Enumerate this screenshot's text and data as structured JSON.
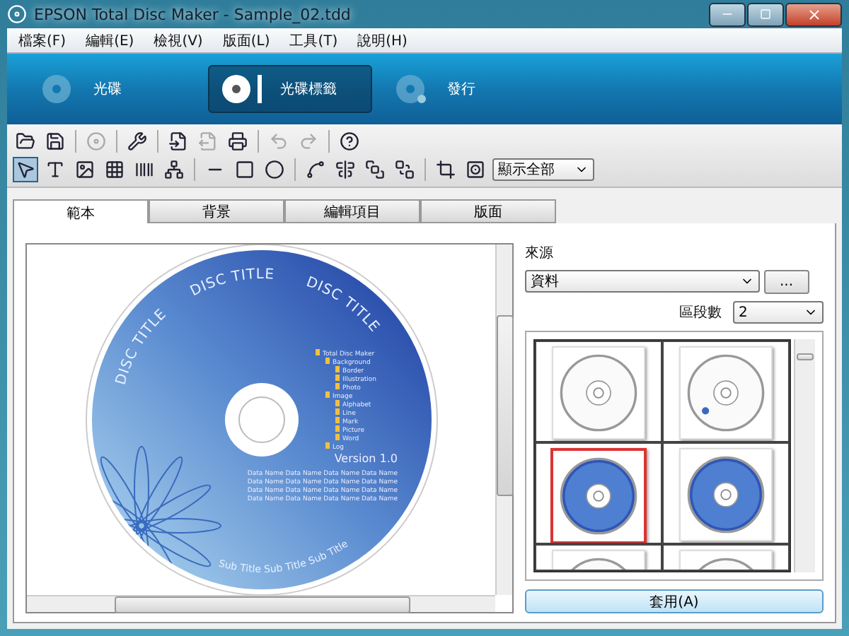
{
  "window": {
    "title": "EPSON Total Disc Maker - Sample_02.tdd"
  },
  "menu": [
    "檔案(F)",
    "編輯(E)",
    "檢視(V)",
    "版面(L)",
    "工具(T)",
    "說明(H)"
  ],
  "modes": [
    {
      "label": "光碟",
      "selected": false,
      "kind": "disc"
    },
    {
      "label": "光碟標籤",
      "selected": true,
      "kind": "label"
    },
    {
      "label": "發行",
      "selected": false,
      "kind": "publish"
    }
  ],
  "toolbar": [
    {
      "kind": "open",
      "disabled": false
    },
    {
      "kind": "save",
      "disabled": false
    },
    {
      "kind": "sep"
    },
    {
      "kind": "disc",
      "disabled": true
    },
    {
      "kind": "sep"
    },
    {
      "kind": "tools",
      "disabled": false
    },
    {
      "kind": "sep"
    },
    {
      "kind": "import",
      "disabled": false
    },
    {
      "kind": "export",
      "disabled": true
    },
    {
      "kind": "print",
      "disabled": false
    },
    {
      "kind": "sep"
    },
    {
      "kind": "undo",
      "disabled": true
    },
    {
      "kind": "redo",
      "disabled": true
    },
    {
      "kind": "sep"
    },
    {
      "kind": "help",
      "disabled": false
    }
  ],
  "tools": [
    {
      "kind": "pointer",
      "selected": true
    },
    {
      "kind": "text",
      "selected": false
    },
    {
      "kind": "image",
      "selected": false
    },
    {
      "kind": "grid",
      "selected": false
    },
    {
      "kind": "barcode",
      "selected": false
    },
    {
      "kind": "tree",
      "selected": false
    },
    {
      "kind": "sep"
    },
    {
      "kind": "line",
      "selected": false
    },
    {
      "kind": "rect",
      "selected": false
    },
    {
      "kind": "ellipse",
      "selected": false
    },
    {
      "kind": "sep"
    },
    {
      "kind": "curve",
      "selected": false
    },
    {
      "kind": "align",
      "selected": false
    },
    {
      "kind": "front",
      "selected": false
    },
    {
      "kind": "back",
      "selected": false
    },
    {
      "kind": "sep"
    },
    {
      "kind": "crop",
      "selected": false
    },
    {
      "kind": "discview",
      "selected": false
    }
  ],
  "view_select": {
    "value": "顯示全部"
  },
  "tabs": [
    {
      "label": "範本",
      "selected": true
    },
    {
      "label": "背景",
      "selected": false
    },
    {
      "label": "編輯項目",
      "selected": false
    },
    {
      "label": "版面",
      "selected": false
    }
  ],
  "disc": {
    "title_parts": [
      "DISC TITLE",
      "DISC TITLE",
      "DISC TITLE"
    ],
    "subtitle": "Sub Title Sub Title Sub Title",
    "version": "Version 1.0",
    "tree": [
      {
        "label": "Total Disc Maker",
        "children": [
          {
            "label": "Background",
            "children": [
              {
                "label": "Border"
              },
              {
                "label": "Illustration"
              },
              {
                "label": "Photo"
              }
            ]
          },
          {
            "label": "Image",
            "children": [
              {
                "label": "Alphabet"
              },
              {
                "label": "Line"
              },
              {
                "label": "Mark"
              },
              {
                "label": "Picture"
              },
              {
                "label": "Word"
              }
            ]
          },
          {
            "label": "Log"
          }
        ]
      }
    ],
    "data_lines": [
      "Data Name Data Name Data Name Data Name",
      "Data Name Data Name Data Name Data Name",
      "Data Name Data Name Data Name Data Name",
      "Data Name Data Name Data Name Data Name"
    ]
  },
  "source": {
    "label": "來源",
    "value": "資料",
    "browse": "..."
  },
  "segments": {
    "label": "區段數",
    "value": "2"
  },
  "thumbnails": [
    {
      "kind": "white",
      "selected": false
    },
    {
      "kind": "white-flower",
      "selected": false
    },
    {
      "kind": "blue",
      "selected": true
    },
    {
      "kind": "blue",
      "selected": false
    },
    {
      "kind": "white",
      "selected": false
    },
    {
      "kind": "white",
      "selected": false
    }
  ],
  "apply_button": "套用(A)"
}
